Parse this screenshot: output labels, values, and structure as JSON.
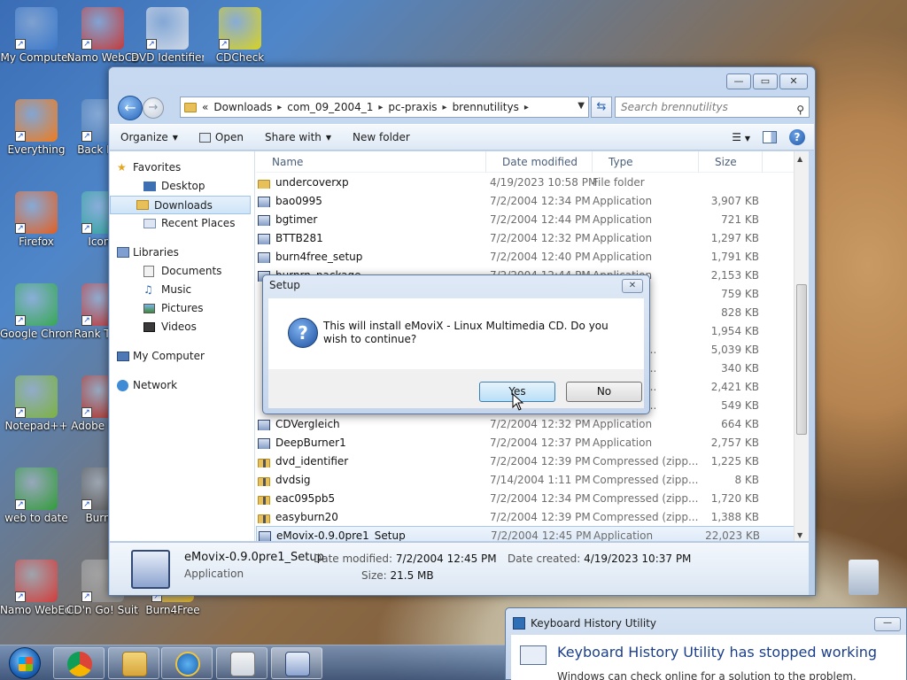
{
  "desktop": {
    "icons": [
      {
        "label": "My Computer",
        "color": "#3b78c9"
      },
      {
        "label": "Namo WebCa",
        "color": "#c43a3a"
      },
      {
        "label": "DVD Identifier",
        "color": "#cfd8e6"
      },
      {
        "label": "CDCheck",
        "color": "#d9d21f"
      },
      {
        "label": "Everything",
        "color": "#f07a1a"
      },
      {
        "label": "Back Mak",
        "color": "#4a7ab5"
      },
      {
        "label": "Firefox",
        "color": "#e35d1f"
      },
      {
        "label": "IconA",
        "color": "#2aa39b"
      },
      {
        "label": "Google Chrome",
        "color": "#34a853"
      },
      {
        "label": "Rank Toolb",
        "color": "#c22f2f"
      },
      {
        "label": "Notepad++",
        "color": "#7bb33f"
      },
      {
        "label": "Adobe F 6.0",
        "color": "#b3261e"
      },
      {
        "label": "web to date",
        "color": "#2f9c3a"
      },
      {
        "label": "Burn'n",
        "color": "#555555"
      },
      {
        "label": "Namo WebEditor...",
        "color": "#d23b3b"
      },
      {
        "label": "CD'n Go! Suite",
        "color": "#8a8a8a"
      },
      {
        "label": "Burn4Free",
        "color": "#d7b02a"
      }
    ]
  },
  "explorer": {
    "window_controls": {
      "minimize": "—",
      "maximize": "▭",
      "close": "✕"
    },
    "breadcrumb": [
      "«",
      "Downloads",
      "com_09_2004_1",
      "pc-praxis",
      "brennutilitys"
    ],
    "search_placeholder": "Search brennutilitys",
    "toolbar": {
      "organize": "Organize",
      "open": "Open",
      "share_with": "Share with",
      "new_folder": "New folder",
      "help": "?"
    },
    "nav": {
      "favorites": "Favorites",
      "desktop": "Desktop",
      "downloads": "Downloads",
      "recent_places": "Recent Places",
      "libraries": "Libraries",
      "documents": "Documents",
      "music": "Music",
      "pictures": "Pictures",
      "videos": "Videos",
      "my_computer": "My Computer",
      "network": "Network"
    },
    "columns": {
      "name": "Name",
      "date": "Date modified",
      "type": "Type",
      "size": "Size"
    },
    "files": [
      {
        "name": "undercoverxp",
        "date": "4/19/2023 10:58 PM",
        "type": "File folder",
        "size": "",
        "icon": "folder"
      },
      {
        "name": "bao0995",
        "date": "7/2/2004 12:34 PM",
        "type": "Application",
        "size": "3,907 KB",
        "icon": "app"
      },
      {
        "name": "bgtimer",
        "date": "7/2/2004 12:44 PM",
        "type": "Application",
        "size": "721 KB",
        "icon": "app"
      },
      {
        "name": "BTTB281",
        "date": "7/2/2004 12:32 PM",
        "type": "Application",
        "size": "1,297 KB",
        "icon": "app"
      },
      {
        "name": "burn4free_setup",
        "date": "7/2/2004 12:40 PM",
        "type": "Application",
        "size": "1,791 KB",
        "icon": "app"
      },
      {
        "name": "burnrn_package",
        "date": "7/2/2004 12:44 PM",
        "type": "Application",
        "size": "2,153 KB",
        "icon": "app"
      },
      {
        "name": "",
        "date": "",
        "type": "",
        "size": "759 KB",
        "icon": "app"
      },
      {
        "name": "",
        "date": "",
        "type": "",
        "size": "828 KB",
        "icon": "app"
      },
      {
        "name": "",
        "date": "",
        "type": "",
        "size": "1,954 KB",
        "icon": "app"
      },
      {
        "name": "",
        "date": "",
        "type": "ssed (zipp...",
        "size": "5,039 KB",
        "icon": "zip"
      },
      {
        "name": "",
        "date": "",
        "type": "ssed (zipp...",
        "size": "340 KB",
        "icon": "zip"
      },
      {
        "name": "",
        "date": "",
        "type": "ssed (zipp...",
        "size": "2,421 KB",
        "icon": "zip"
      },
      {
        "name": "",
        "date": "",
        "type": "ssed (zipp...",
        "size": "549 KB",
        "icon": "zip"
      },
      {
        "name": "CDVergleich",
        "date": "7/2/2004 12:32 PM",
        "type": "Application",
        "size": "664 KB",
        "icon": "app"
      },
      {
        "name": "DeepBurner1",
        "date": "7/2/2004 12:37 PM",
        "type": "Application",
        "size": "2,757 KB",
        "icon": "app"
      },
      {
        "name": "dvd_identifier",
        "date": "7/2/2004 12:39 PM",
        "type": "Compressed (zipp...",
        "size": "1,225 KB",
        "icon": "zip"
      },
      {
        "name": "dvdsig",
        "date": "7/14/2004 1:11 PM",
        "type": "Compressed (zipp...",
        "size": "8 KB",
        "icon": "zip"
      },
      {
        "name": "eac095pb5",
        "date": "7/2/2004 12:34 PM",
        "type": "Compressed (zipp...",
        "size": "1,720 KB",
        "icon": "zip"
      },
      {
        "name": "easyburn20",
        "date": "7/2/2004 12:39 PM",
        "type": "Compressed (zipp...",
        "size": "1,388 KB",
        "icon": "zip"
      },
      {
        "name": "eMovix-0.9.0pre1_Setup",
        "date": "7/2/2004 12:45 PM",
        "type": "Application",
        "size": "22,023 KB",
        "icon": "app",
        "selected": true
      }
    ],
    "details": {
      "name": "eMovix-0.9.0pre1_Setup",
      "type": "Application",
      "date_modified_label": "Date modified:",
      "date_modified": "7/2/2004 12:45 PM",
      "date_created_label": "Date created:",
      "date_created": "4/19/2023 10:37 PM",
      "size_label": "Size:",
      "size": "21.5 MB"
    }
  },
  "setup_dialog": {
    "title": "Setup",
    "close": "✕",
    "message": "This will install eMoviX - Linux Multimedia CD. Do you wish to continue?",
    "yes": "Yes",
    "no": "No"
  },
  "keyboard_history": {
    "title": "Keyboard History Utility",
    "minimize": "—",
    "heading": "Keyboard History Utility has stopped working",
    "sub": "Windows can check online for a solution to the problem."
  },
  "taskbar": {
    "apps": [
      "chrome",
      "explorer",
      "internet-explorer",
      "notepad",
      "setup"
    ]
  }
}
